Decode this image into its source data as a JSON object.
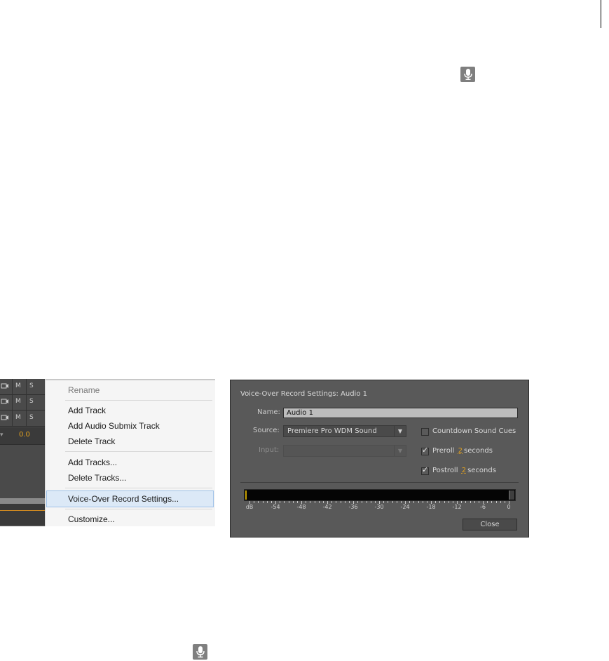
{
  "track_strip": {
    "rows": [
      {
        "m": "M",
        "s": "S"
      },
      {
        "m": "M",
        "s": "S"
      },
      {
        "m": "M",
        "s": "S"
      }
    ],
    "volume": "0.0"
  },
  "context_menu": {
    "items": [
      {
        "label": "Rename",
        "enabled": false
      },
      {
        "label": "Add Track",
        "enabled": true
      },
      {
        "label": "Add Audio Submix Track",
        "enabled": true
      },
      {
        "label": "Delete Track",
        "enabled": true
      },
      {
        "label": "Add Tracks...",
        "enabled": true
      },
      {
        "label": "Delete Tracks...",
        "enabled": true
      },
      {
        "label": "Voice-Over Record Settings...",
        "enabled": true,
        "highlighted": true
      },
      {
        "label": "Customize...",
        "enabled": true
      }
    ]
  },
  "dialog": {
    "title": "Voice-Over Record Settings: Audio 1",
    "name_label": "Name:",
    "name_value": "Audio 1",
    "source_label": "Source:",
    "source_value": "Premiere Pro WDM Sound",
    "input_label": "Input:",
    "countdown_label": "Countdown Sound Cues",
    "countdown_checked": false,
    "preroll_label": "Preroll",
    "preroll_value": "2",
    "preroll_unit": "seconds",
    "preroll_checked": true,
    "postroll_label": "Postroll",
    "postroll_value": "2",
    "postroll_unit": "seconds",
    "postroll_checked": true,
    "meter_scale": [
      "dB",
      "-54",
      "-48",
      "-42",
      "-36",
      "-30",
      "-24",
      "-18",
      "-12",
      "-6",
      "0"
    ],
    "close_label": "Close"
  },
  "colors": {
    "dialog_bg": "#595959",
    "accent_value": "#e0a020",
    "menu_highlight": "#dce9f7"
  },
  "icons": [
    "microphone-icon",
    "camera-icon",
    "dropdown-arrow-icon",
    "checkbox-check-icon"
  ]
}
